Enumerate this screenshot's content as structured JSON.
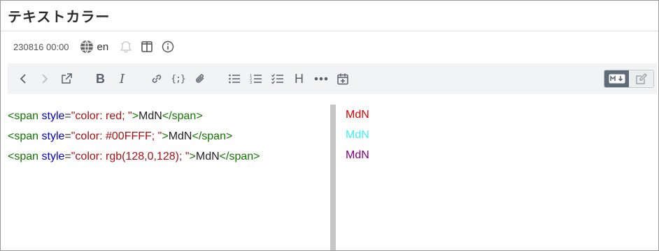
{
  "title": "テキストカラー",
  "meta": {
    "time": "230816 00:00",
    "lang": "en"
  },
  "toolbar": {
    "bold_label": "B",
    "italic_label": "I",
    "code_label": "{;}",
    "heading_label": "H"
  },
  "code_lines": [
    {
      "open": "<span",
      "attr": "style",
      "eq": "=",
      "value": "\"color: red; \"",
      "gt": ">",
      "text": "MdN",
      "close": "</span>"
    },
    {
      "open": "<span",
      "attr": "style",
      "eq": "=",
      "value": "\"color: #00FFFF; \"",
      "gt": ">",
      "text": "MdN",
      "close": "</span>"
    },
    {
      "open": "<span",
      "attr": "style",
      "eq": "=",
      "value": "\"color: rgb(128,0,128); \"",
      "gt": ">",
      "text": "MdN",
      "close": "</span>"
    }
  ],
  "preview": [
    {
      "text": "MdN",
      "color": "#e00000"
    },
    {
      "text": "MdN",
      "color": "#3ff0ff"
    },
    {
      "text": "MdN",
      "color": "#800080"
    }
  ],
  "colors": {
    "tag": "#117700",
    "attr": "#0000cc",
    "string": "#aa1111",
    "toolbar_bg": "#f1f3f5",
    "mode_active": "#5f6b78"
  }
}
